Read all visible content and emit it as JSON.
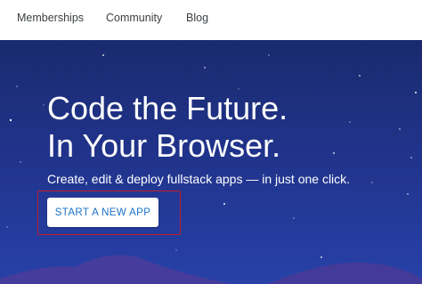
{
  "nav": {
    "items": [
      {
        "label": "Memberships"
      },
      {
        "label": "Community"
      },
      {
        "label": "Blog"
      }
    ]
  },
  "hero": {
    "headline_line1": "Code the Future.",
    "headline_line2": "In Your Browser.",
    "subtitle": "Create, edit & deploy fullstack apps — in just one click.",
    "cta_label": "START A NEW APP"
  },
  "colors": {
    "hero_background": "#20338a",
    "cta_text": "#1a73c8",
    "highlight_border": "#c21d2a"
  }
}
